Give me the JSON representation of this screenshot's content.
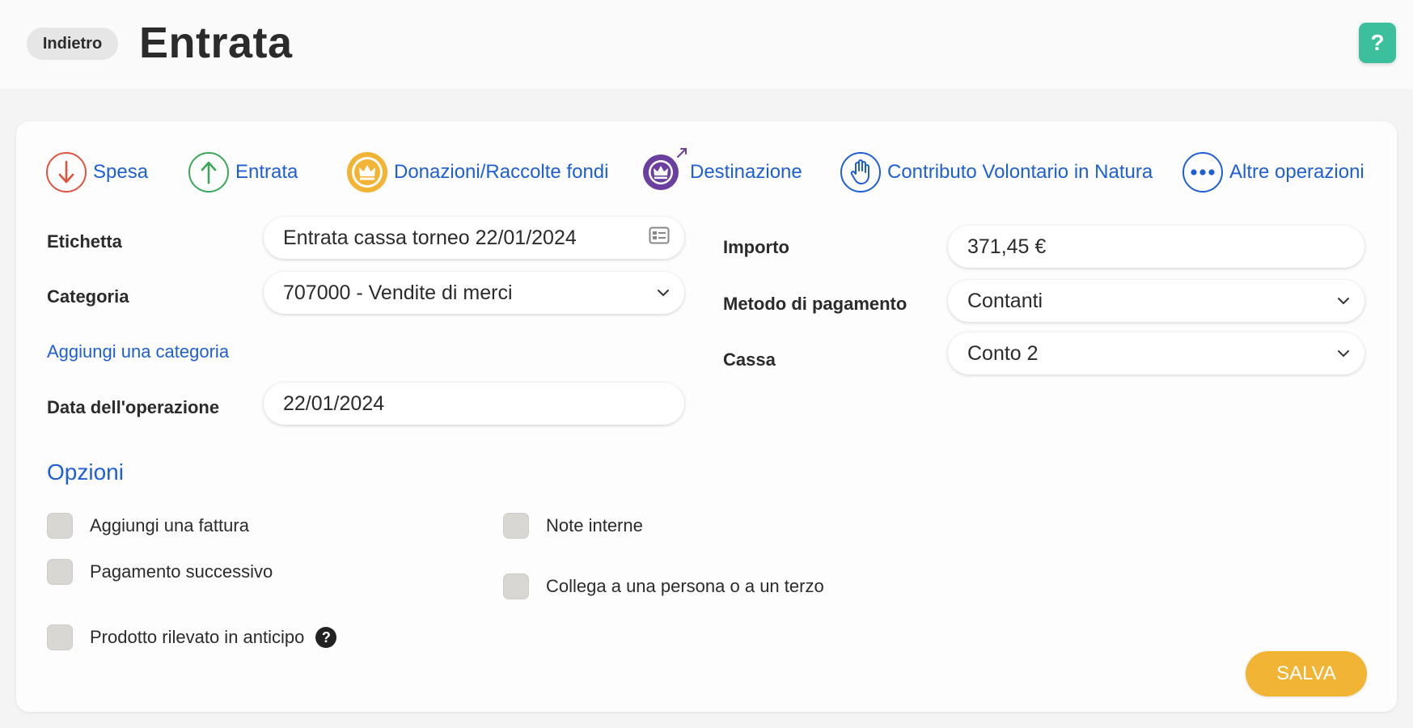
{
  "header": {
    "back_label": "Indietro",
    "title": "Entrata",
    "help_label": "?"
  },
  "operation_tabs": [
    {
      "label": "Spesa",
      "icon": "arrow-down-icon",
      "color": "#e0533f"
    },
    {
      "label": "Entrata",
      "icon": "arrow-up-icon",
      "color": "#3aa85a"
    },
    {
      "label": "Donazioni/Raccolte fondi",
      "icon": "crown-icon",
      "color": "#f2b434"
    },
    {
      "label": "Destinazione",
      "icon": "crown-arrow-icon",
      "color": "#6b3fa0"
    },
    {
      "label": "Contributo Volontario in Natura",
      "icon": "hand-icon",
      "color": "#1f5fd6"
    },
    {
      "label": "Altre operazioni",
      "icon": "more-dots-icon",
      "color": "#1f5fd6"
    }
  ],
  "form": {
    "etichetta_label": "Etichetta",
    "etichetta_value": "Entrata cassa torneo 22/01/2024",
    "categoria_label": "Categoria",
    "categoria_value": "707000 - Vendite di merci",
    "add_category_label": "Aggiungi una categoria",
    "data_label": "Data dell'operazione",
    "data_value": "22/01/2024",
    "importo_label": "Importo",
    "importo_value": "371,45 €",
    "metodo_label": "Metodo di pagamento",
    "metodo_value": "Contanti",
    "cassa_label": "Cassa",
    "cassa_value": "Conto 2"
  },
  "options": {
    "title": "Opzioni",
    "items": [
      {
        "label": "Aggiungi una fattura",
        "checked": false
      },
      {
        "label": "Pagamento successivo",
        "checked": false
      },
      {
        "label": "Prodotto rilevato in anticipo",
        "checked": false
      },
      {
        "label": "Note interne",
        "checked": false
      },
      {
        "label": "Collega a una persona o a un terzo",
        "checked": false
      }
    ],
    "help_glyph": "?"
  },
  "save_label": "SALVA",
  "colors": {
    "accent_link": "#1f5fd6",
    "help_button": "#3bbf9c",
    "save_button": "#f2b434"
  }
}
